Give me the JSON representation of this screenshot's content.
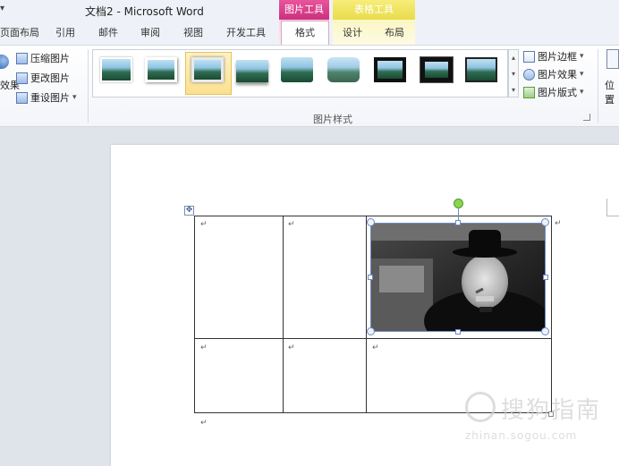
{
  "window": {
    "title": "文档2 - Microsoft Word",
    "quick_access_arrow": "▾"
  },
  "context_tabs": {
    "picture_tools": "图片工具",
    "table_tools": "表格工具"
  },
  "tabs": [
    {
      "label": "页面布局"
    },
    {
      "label": "引用"
    },
    {
      "label": "邮件"
    },
    {
      "label": "审阅"
    },
    {
      "label": "视图"
    },
    {
      "label": "开发工具"
    },
    {
      "label": "格式",
      "active": true
    },
    {
      "label": "设计"
    },
    {
      "label": "布局"
    }
  ],
  "adjust_group": {
    "effects_label": "效果",
    "items": [
      "压缩图片",
      "更改图片",
      "重设图片"
    ],
    "reset_arrow": "▾"
  },
  "picture_styles": {
    "group_label": "图片样式",
    "selected_index": 2,
    "thumbnail_count": 9,
    "options": [
      {
        "label": "图片边框",
        "arrow": "▾"
      },
      {
        "label": "图片效果",
        "arrow": "▾"
      },
      {
        "label": "图片版式",
        "arrow": "▾"
      }
    ],
    "scroll_up": "▴",
    "scroll_down": "▾",
    "scroll_more": "▾"
  },
  "arrange": {
    "position_label": "位置",
    "position_arrow": "▾"
  },
  "document": {
    "paragraph_mark": "↵",
    "table_move_handle": "✥",
    "table": {
      "rows": 2,
      "cols": 3,
      "picture_cell": "row 1, col 3"
    }
  },
  "watermark": {
    "text": "搜狗指南",
    "url": "zhinan.sogou.com"
  },
  "colors": {
    "picture_tools_accent": "#cc2f7e",
    "table_tools_accent": "#e8dc4a",
    "rotate_handle": "#8bd44e",
    "selection_border": "#6d8cc2"
  }
}
